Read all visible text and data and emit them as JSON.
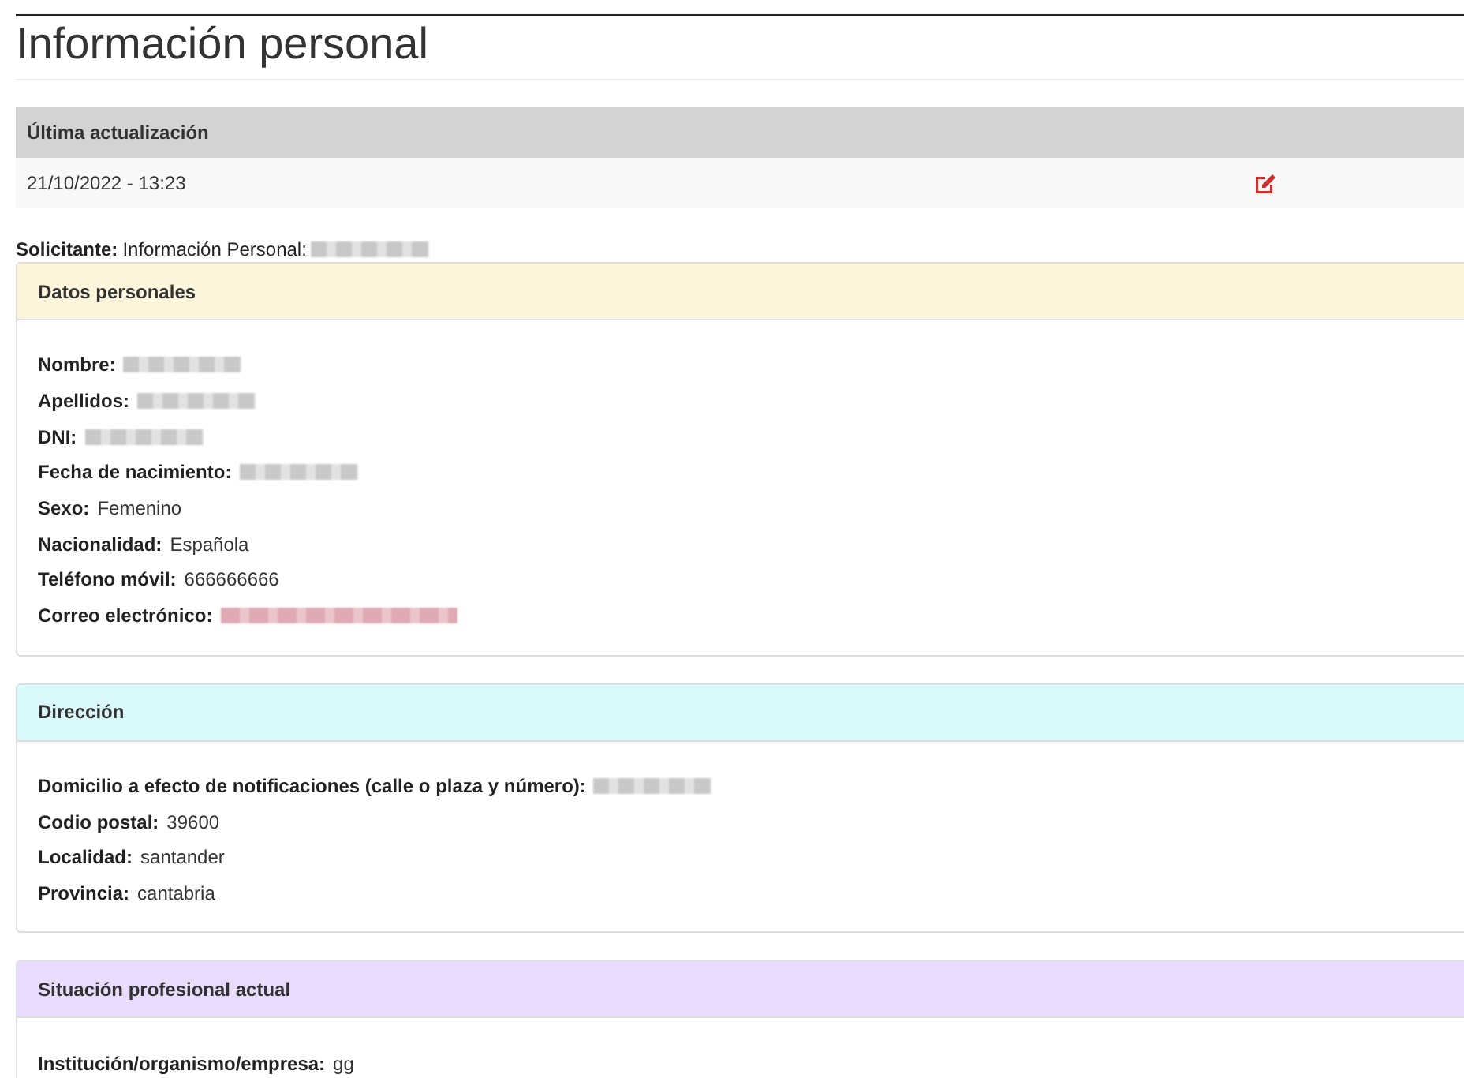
{
  "title": "Información personal",
  "update_table": {
    "header": "Última actualización",
    "value": "21/10/2022 - 13:23"
  },
  "applicant": {
    "label": "Solicitante:",
    "text": "Información Personal:",
    "kind": "redacted"
  },
  "sections": [
    {
      "title": "Datos personales",
      "color": "#fcf5db",
      "fields": [
        {
          "label": "Nombre:",
          "kind": "redacted"
        },
        {
          "label": "Apellidos:",
          "kind": "redacted"
        },
        {
          "label": "DNI:",
          "kind": "redacted"
        },
        {
          "label": "Fecha de nacimiento:",
          "kind": "redacted"
        },
        {
          "label": "Sexo:",
          "kind": "text",
          "value": "Femenino"
        },
        {
          "label": "Nacionalidad:",
          "kind": "text",
          "value": "Española"
        },
        {
          "label": "Teléfono móvil:",
          "kind": "text",
          "value": "666666666"
        },
        {
          "label": "Correo electrónico:",
          "kind": "redacted-link"
        }
      ]
    },
    {
      "title": "Dirección",
      "color": "#d9f9fc",
      "fields": [
        {
          "label": "Domicilio a efecto de notificaciones (calle o plaza y número):",
          "kind": "redacted"
        },
        {
          "label": "Codio postal:",
          "kind": "text",
          "value": "39600"
        },
        {
          "label": "Localidad:",
          "kind": "text",
          "value": "santander"
        },
        {
          "label": "Provincia:",
          "kind": "text",
          "value": "cantabria"
        }
      ]
    },
    {
      "title": "Situación profesional actual",
      "color": "#e9dbfb",
      "fields": [
        {
          "label": "Institución/organismo/empresa:",
          "kind": "text",
          "value": "gg"
        }
      ]
    }
  ]
}
